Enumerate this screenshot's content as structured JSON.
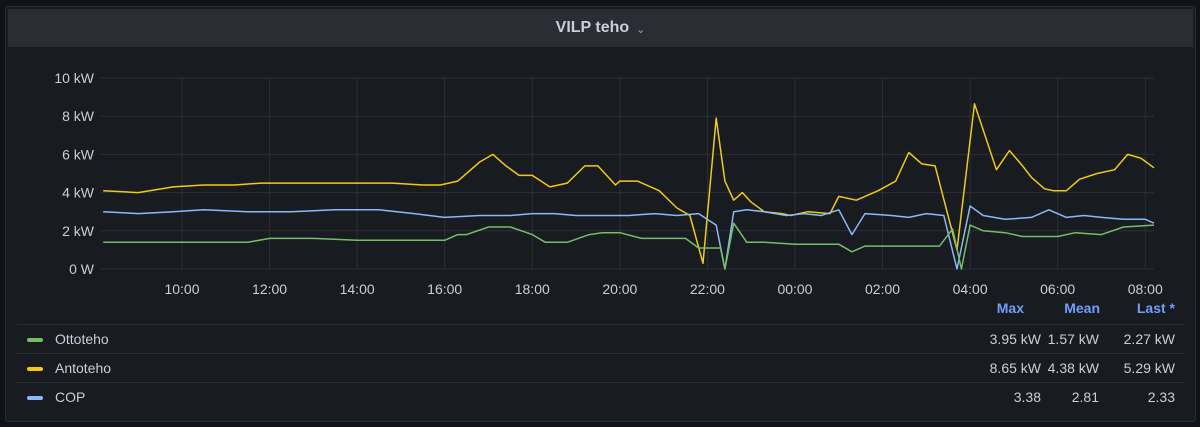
{
  "panel": {
    "title": "VILP teho"
  },
  "legend": {
    "columns": [
      "Max",
      "Mean",
      "Last *"
    ],
    "rows": [
      {
        "name": "Ottoteho",
        "color": "#73bf69",
        "max": "3.95 kW",
        "mean": "1.57 kW",
        "last": "2.27 kW"
      },
      {
        "name": "Antoteho",
        "color": "#f2cc0c",
        "max": "8.65 kW",
        "mean": "4.38 kW",
        "last": "5.29 kW"
      },
      {
        "name": "COP",
        "color": "#8ab8ff",
        "max": "3.38",
        "mean": "2.81",
        "last": "2.33"
      }
    ]
  },
  "chart_data": {
    "type": "line",
    "y_ticks": [
      "0 W",
      "2 kW",
      "4 kW",
      "6 kW",
      "8 kW",
      "10 kW"
    ],
    "ylim": [
      0,
      10
    ],
    "x_ticks": [
      "10:00",
      "12:00",
      "14:00",
      "16:00",
      "18:00",
      "20:00",
      "22:00",
      "00:00",
      "02:00",
      "04:00",
      "06:00",
      "08:00"
    ],
    "xlim_hours": [
      8.15,
      32.2
    ],
    "grid": true,
    "series": [
      {
        "name": "Antoteho",
        "color": "#f2cc0c",
        "x": [
          8.2,
          9.0,
          9.8,
          10.5,
          11.2,
          11.8,
          12.5,
          13.3,
          14.0,
          14.8,
          15.5,
          15.9,
          16.3,
          16.8,
          17.1,
          17.4,
          17.7,
          18.0,
          18.4,
          18.8,
          19.2,
          19.5,
          19.9,
          20.0,
          20.4,
          20.9,
          21.3,
          21.6,
          21.9,
          22.2,
          22.4,
          22.6,
          22.8,
          23.0,
          23.3,
          23.7,
          23.9,
          24.3,
          24.8,
          25.0,
          25.4,
          25.9,
          26.3,
          26.6,
          26.9,
          27.2,
          27.7,
          28.1,
          28.6,
          28.9,
          29.2,
          29.4,
          29.7,
          29.9,
          30.2,
          30.5,
          30.9,
          31.3,
          31.6,
          31.9,
          32.2
        ],
        "y": [
          4.1,
          4.0,
          4.3,
          4.4,
          4.4,
          4.5,
          4.5,
          4.5,
          4.5,
          4.5,
          4.4,
          4.4,
          4.6,
          5.6,
          6.0,
          5.4,
          4.9,
          4.9,
          4.3,
          4.5,
          5.4,
          5.4,
          4.4,
          4.6,
          4.6,
          4.1,
          3.2,
          2.8,
          0.3,
          7.9,
          4.6,
          3.6,
          4.0,
          3.5,
          3.0,
          2.9,
          2.8,
          3.0,
          2.9,
          3.8,
          3.6,
          4.1,
          4.6,
          6.1,
          5.5,
          5.4,
          1.0,
          8.65,
          5.2,
          6.2,
          5.4,
          4.8,
          4.2,
          4.1,
          4.1,
          4.7,
          5.0,
          5.2,
          6.0,
          5.8,
          5.3
        ]
      },
      {
        "name": "COP",
        "color": "#8ab8ff",
        "x": [
          8.2,
          9.0,
          9.8,
          10.5,
          11.5,
          12.5,
          13.5,
          14.5,
          15.3,
          16.0,
          16.8,
          17.5,
          18.0,
          18.5,
          19.0,
          19.6,
          20.2,
          20.8,
          21.3,
          21.8,
          22.2,
          22.4,
          22.6,
          22.9,
          23.3,
          23.8,
          24.2,
          24.6,
          25.0,
          25.3,
          25.6,
          26.2,
          26.6,
          27.0,
          27.4,
          27.7,
          28.0,
          28.3,
          28.8,
          29.4,
          29.8,
          30.2,
          30.6,
          31.0,
          31.5,
          32.0,
          32.2
        ],
        "y": [
          3.0,
          2.9,
          3.0,
          3.1,
          3.0,
          3.0,
          3.1,
          3.1,
          2.9,
          2.7,
          2.8,
          2.8,
          2.9,
          2.9,
          2.8,
          2.8,
          2.8,
          2.9,
          2.8,
          2.9,
          2.3,
          0.0,
          3.0,
          3.1,
          3.0,
          2.8,
          2.9,
          2.8,
          3.1,
          1.8,
          2.9,
          2.8,
          2.7,
          2.9,
          2.8,
          0.0,
          3.3,
          2.8,
          2.6,
          2.7,
          3.1,
          2.7,
          2.8,
          2.7,
          2.6,
          2.6,
          2.4
        ]
      },
      {
        "name": "Ottoteho",
        "color": "#73bf69",
        "x": [
          8.2,
          9.0,
          10.0,
          11.5,
          12.0,
          12.5,
          13.0,
          14.0,
          15.0,
          15.5,
          16.0,
          16.3,
          16.5,
          17.0,
          17.5,
          18.0,
          18.3,
          18.8,
          19.3,
          19.6,
          20.0,
          20.5,
          21.0,
          21.5,
          21.8,
          22.0,
          22.3,
          22.4,
          22.6,
          22.9,
          23.3,
          24.0,
          24.5,
          25.0,
          25.3,
          25.6,
          26.0,
          26.5,
          27.0,
          27.3,
          27.6,
          27.8,
          28.0,
          28.3,
          28.8,
          29.2,
          29.5,
          30.0,
          30.4,
          31.0,
          31.5,
          32.2
        ],
        "y": [
          1.4,
          1.4,
          1.4,
          1.4,
          1.6,
          1.6,
          1.6,
          1.5,
          1.5,
          1.5,
          1.5,
          1.8,
          1.8,
          2.2,
          2.2,
          1.8,
          1.4,
          1.4,
          1.8,
          1.9,
          1.9,
          1.6,
          1.6,
          1.6,
          1.1,
          1.1,
          1.1,
          0.0,
          2.4,
          1.4,
          1.4,
          1.3,
          1.3,
          1.3,
          0.9,
          1.2,
          1.2,
          1.2,
          1.2,
          1.2,
          2.1,
          0.0,
          2.3,
          2.0,
          1.9,
          1.7,
          1.7,
          1.7,
          1.9,
          1.8,
          2.2,
          2.3
        ]
      }
    ]
  }
}
